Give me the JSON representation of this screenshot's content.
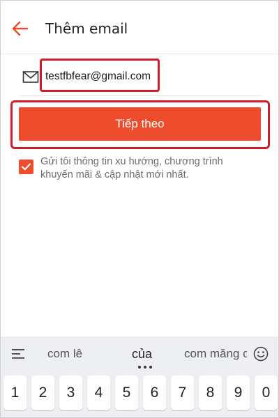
{
  "header": {
    "title": "Thêm email"
  },
  "email": {
    "value": "testfbfear@gmail.com",
    "placeholder": ""
  },
  "next_button": {
    "label": "Tiếp theo"
  },
  "promo_checkbox": {
    "checked": true,
    "text": "Gửi tôi thông tin xu hướng, chương trình khuyến mãi & cập nhật mới nhất."
  },
  "keyboard": {
    "suggestions": [
      "com lê",
      "của",
      "com măng c"
    ],
    "number_keys": [
      "1",
      "2",
      "3",
      "4",
      "5",
      "6",
      "7",
      "8",
      "9",
      "0"
    ]
  },
  "colors": {
    "accent": "#ee4d2d",
    "highlight_box": "#d11a2a"
  },
  "icons": {
    "back": "arrow-left-icon",
    "mail": "envelope-icon",
    "check": "checkmark-icon",
    "keyboard_menu": "menu-icon",
    "emoji": "smiley-icon"
  }
}
